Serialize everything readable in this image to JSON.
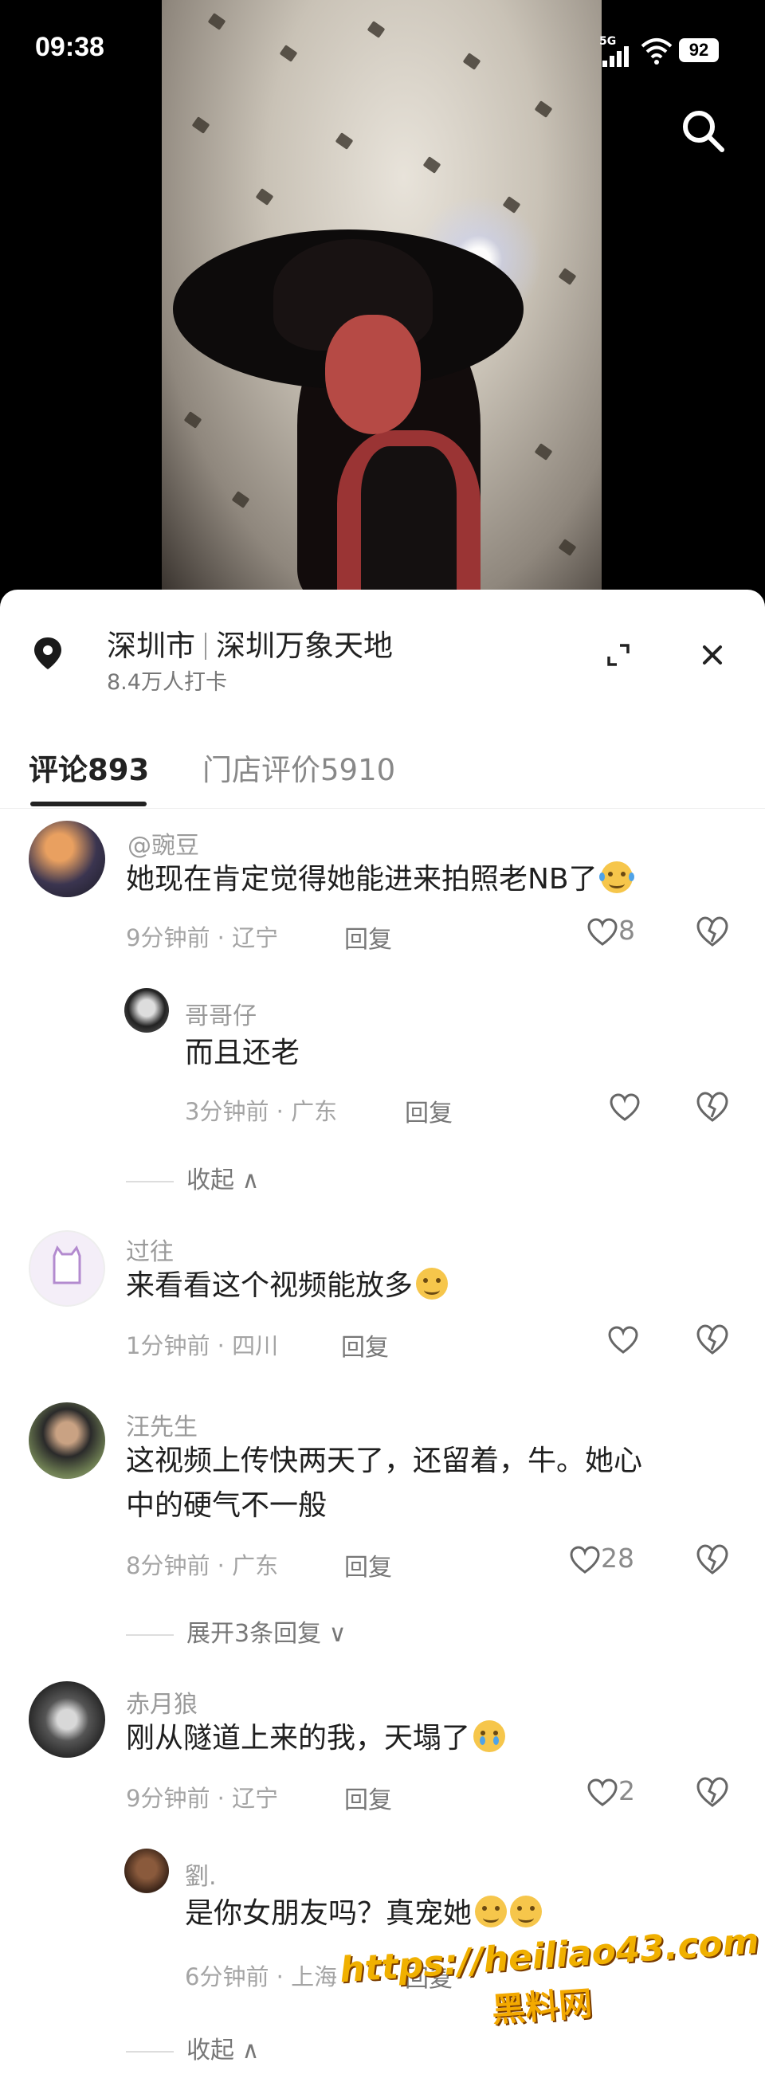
{
  "status_bar": {
    "time": "09:38",
    "network": "5G",
    "battery": "92"
  },
  "location": {
    "city": "深圳市",
    "place": "深圳万象天地",
    "checkins": "8.4万人打卡"
  },
  "tabs": [
    {
      "label": "评论893",
      "active": true
    },
    {
      "label": "门店评价5910",
      "active": false
    }
  ],
  "reply_label": "回复",
  "comments": [
    {
      "user": "@豌豆",
      "text": "她现在肯定觉得她能进来拍照老NB了",
      "emoji": "laugh-cry",
      "meta": "9分钟前 · 辽宁",
      "likes": "8"
    },
    {
      "user": "哥哥仔",
      "text": "而且还老",
      "meta": "3分钟前 · 广东",
      "likes": "",
      "is_reply": true
    },
    {
      "user": "过往",
      "text": "来看看这个视频能放多",
      "emoji": "smile",
      "meta": "1分钟前 · 四川",
      "likes": ""
    },
    {
      "user": "汪先生",
      "text_line1": "这视频上传快两天了，还留着，牛。她心",
      "text_line2": "中的硬气不一般",
      "meta": "8分钟前 · 广东",
      "likes": "28"
    },
    {
      "user": "赤月狼",
      "text": "刚从隧道上来的我，天塌了",
      "emoji": "crying",
      "meta": "9分钟前 · 辽宁",
      "likes": "2"
    },
    {
      "user": "劉.",
      "text": "是你女朋友吗？真宠她",
      "emoji": "grin-grin",
      "meta": "6分钟前 · 上海",
      "likes": "",
      "is_reply": true
    }
  ],
  "toggles": {
    "collapse1": "收起",
    "expand": "展开3条回复",
    "collapse2": "收起"
  },
  "watermark": {
    "line1": "https://heiliao43.com",
    "line2": "黑料网"
  },
  "colors": {
    "panel_bg": "#ffffff",
    "text": "#1f1f1f",
    "meta": "#a4a4a4",
    "watermark": "#f0b000"
  },
  "icons": [
    "search-icon",
    "location-pin-icon",
    "expand-icon",
    "close-icon",
    "heart-icon",
    "dislike-heart-icon"
  ]
}
